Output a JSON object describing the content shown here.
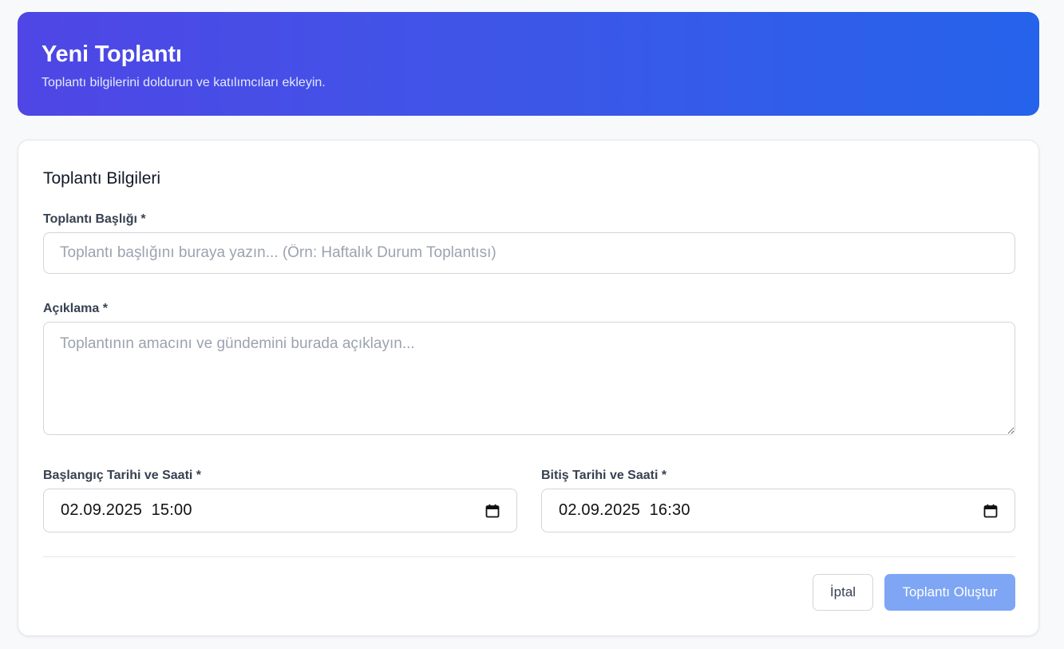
{
  "header": {
    "title": "Yeni Toplantı",
    "subtitle": "Toplantı bilgilerini doldurun ve katılımcıları ekleyin."
  },
  "form": {
    "section_title": "Toplantı Bilgileri",
    "title_field": {
      "label": "Toplantı Başlığı *",
      "value": "",
      "placeholder": "Toplantı başlığını buraya yazın... (Örn: Haftalık Durum Toplantısı)"
    },
    "description_field": {
      "label": "Açıklama *",
      "value": "",
      "placeholder": "Toplantının amacını ve gündemini burada açıklayın..."
    },
    "start_field": {
      "label": "Başlangıç Tarihi ve Saati *",
      "value": "02.09.2025  15:00",
      "icon": "calendar-icon"
    },
    "end_field": {
      "label": "Bitiş Tarihi ve Saati *",
      "value": "02.09.2025  16:30",
      "icon": "calendar-icon"
    }
  },
  "actions": {
    "cancel_label": "İptal",
    "create_label": "Toplantı Oluştur"
  },
  "colors": {
    "header_gradient_start": "#4f46e5",
    "header_gradient_end": "#2563eb",
    "primary_disabled": "#7ea6f4"
  }
}
